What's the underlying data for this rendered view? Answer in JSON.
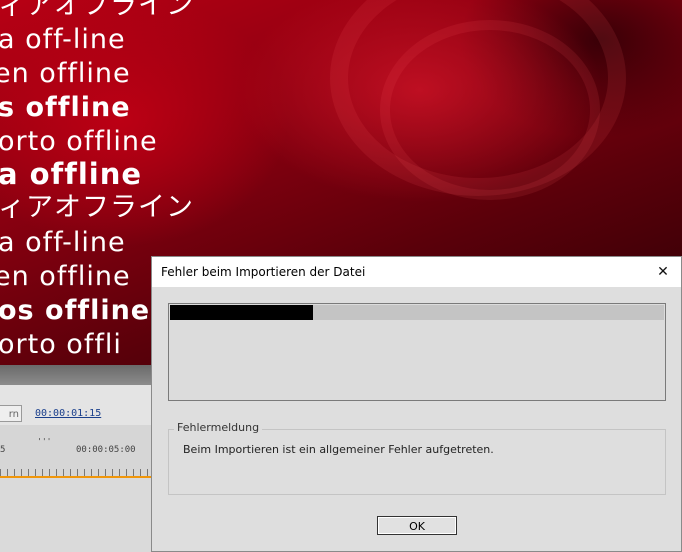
{
  "background": {
    "offline_lines": [
      "ィアオフライン",
      "a off-line",
      "en offline",
      "s offline",
      "orto offline",
      "a offline",
      "ィアオフライン",
      "a off-line",
      "en offline",
      "os offline",
      "orto offli"
    ]
  },
  "editor": {
    "button_stub": "rn",
    "timecode": "00:00:01:15",
    "ruler_label_left": "5",
    "ruler_label_right": "00:00:05:00",
    "playhead_marker": "'''"
  },
  "dialog": {
    "title": "Fehler beim Importieren der Datei",
    "close_glyph": "✕",
    "progress_fraction": 0.29,
    "group_title": "Fehlermeldung",
    "message": "Beim Importieren ist ein allgemeiner Fehler aufgetreten.",
    "ok_label": "OK"
  },
  "colors": {
    "background_red": "#b80014",
    "timeline_accent": "#f0960a",
    "timecode_link": "#1a3f8c"
  }
}
